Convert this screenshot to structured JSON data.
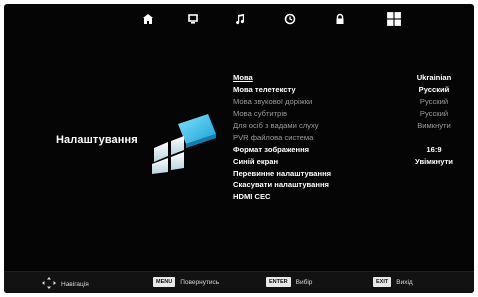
{
  "top_icons": [
    {
      "name": "picture-icon"
    },
    {
      "name": "screen-icon"
    },
    {
      "name": "music-note-icon"
    },
    {
      "name": "clock-icon"
    },
    {
      "name": "lock-icon"
    },
    {
      "name": "settings-grid-icon"
    }
  ],
  "section_title": "Налаштування",
  "menu": {
    "items": [
      {
        "label": "Мова",
        "value": "Ukrainian"
      },
      {
        "label": "Мова телетексту",
        "value": "Русский"
      },
      {
        "label": "Мова звукової доріжки",
        "value": "Русский"
      },
      {
        "label": "Мова субтитрів",
        "value": "Русский"
      },
      {
        "label": "Для осіб з вадами слуху",
        "value": "Вимкнути"
      },
      {
        "label": "PVR файлова система",
        "value": ""
      },
      {
        "label": "Формат зображення",
        "value": "16:9"
      },
      {
        "label": "Синій екран",
        "value": "Увімкнути"
      },
      {
        "label": "Перевинне налаштування",
        "value": ""
      },
      {
        "label": "Скасувати налаштування",
        "value": ""
      },
      {
        "label": "HDMI CEC",
        "value": ""
      }
    ]
  },
  "bottom": {
    "navigate_label": "Навігація",
    "menu_key": "MENU",
    "menu_label": "Повернутись",
    "enter_key": "ENTER",
    "enter_label": "Вибір",
    "exit_key": "EXIT",
    "exit_label": "Вихід"
  },
  "colors": {
    "background": "#050505",
    "logo_accent": "#2fb7e6"
  }
}
